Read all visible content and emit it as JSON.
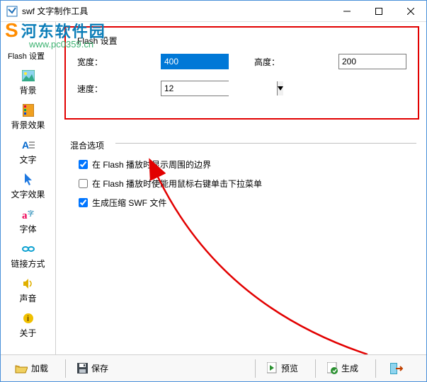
{
  "window": {
    "title": "swf 文字制作工具"
  },
  "watermark": {
    "cn": "河东软件园",
    "url": "www.pc0359.cn"
  },
  "sidebar": {
    "header": "Flash 设置",
    "items": [
      {
        "label": "背景"
      },
      {
        "label": "背景效果"
      },
      {
        "label": "文字"
      },
      {
        "label": "文字效果"
      },
      {
        "label": "字体"
      },
      {
        "label": "链接方式"
      },
      {
        "label": "声音"
      },
      {
        "label": "关于"
      }
    ]
  },
  "flash_settings": {
    "title": "Flash 设置",
    "width_label": "宽度：",
    "width_value": "400",
    "height_label": "高度：",
    "height_value": "200",
    "speed_label": "速度：",
    "speed_value": "12"
  },
  "mix_options": {
    "title": "混合选项",
    "opt1": "在 Flash 播放时显示周围的边界",
    "opt2": "在 Flash 播放时使能用鼠标右键单击下拉菜单",
    "opt3": "生成压缩 SWF 文件"
  },
  "bottombar": {
    "load": "加载",
    "save": "保存",
    "preview": "预览",
    "generate": "生成"
  }
}
